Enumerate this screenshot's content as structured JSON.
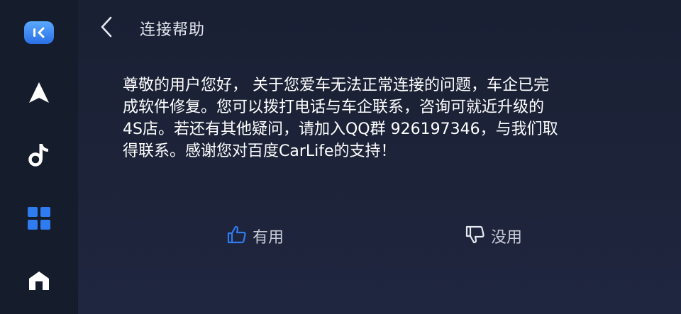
{
  "colors": {
    "accent": "#2f7bf0",
    "text_primary": "#ffffff",
    "text_secondary": "#c9ccd6",
    "sidebar_bg": "#151c2c",
    "main_bg": "#1b2136"
  },
  "sidebar": {
    "items": [
      {
        "icon": "carlife-logo-icon",
        "active": false
      },
      {
        "icon": "navigation-arrow-icon",
        "active": false
      },
      {
        "icon": "music-note-icon",
        "active": false
      },
      {
        "icon": "apps-grid-icon",
        "active": true
      },
      {
        "icon": "home-icon",
        "active": false
      }
    ]
  },
  "header": {
    "back_icon": "chevron-left-icon",
    "title": "连接帮助"
  },
  "content": {
    "lines": [
      "尊敬的用户您好， 关于您爱车无法正常连接的问题，车企已完",
      "成软件修复。您可以拨打电话与车企联系，咨询可就近升级的",
      "4S店。若还有其他疑问，请加入QQ群 926197346，与我们取",
      "得联系。感谢您对百度CarLife的支持！"
    ]
  },
  "feedback": {
    "useful": {
      "icon": "thumbs-up-icon",
      "label": "有用"
    },
    "useless": {
      "icon": "thumbs-down-icon",
      "label": "没用"
    }
  }
}
